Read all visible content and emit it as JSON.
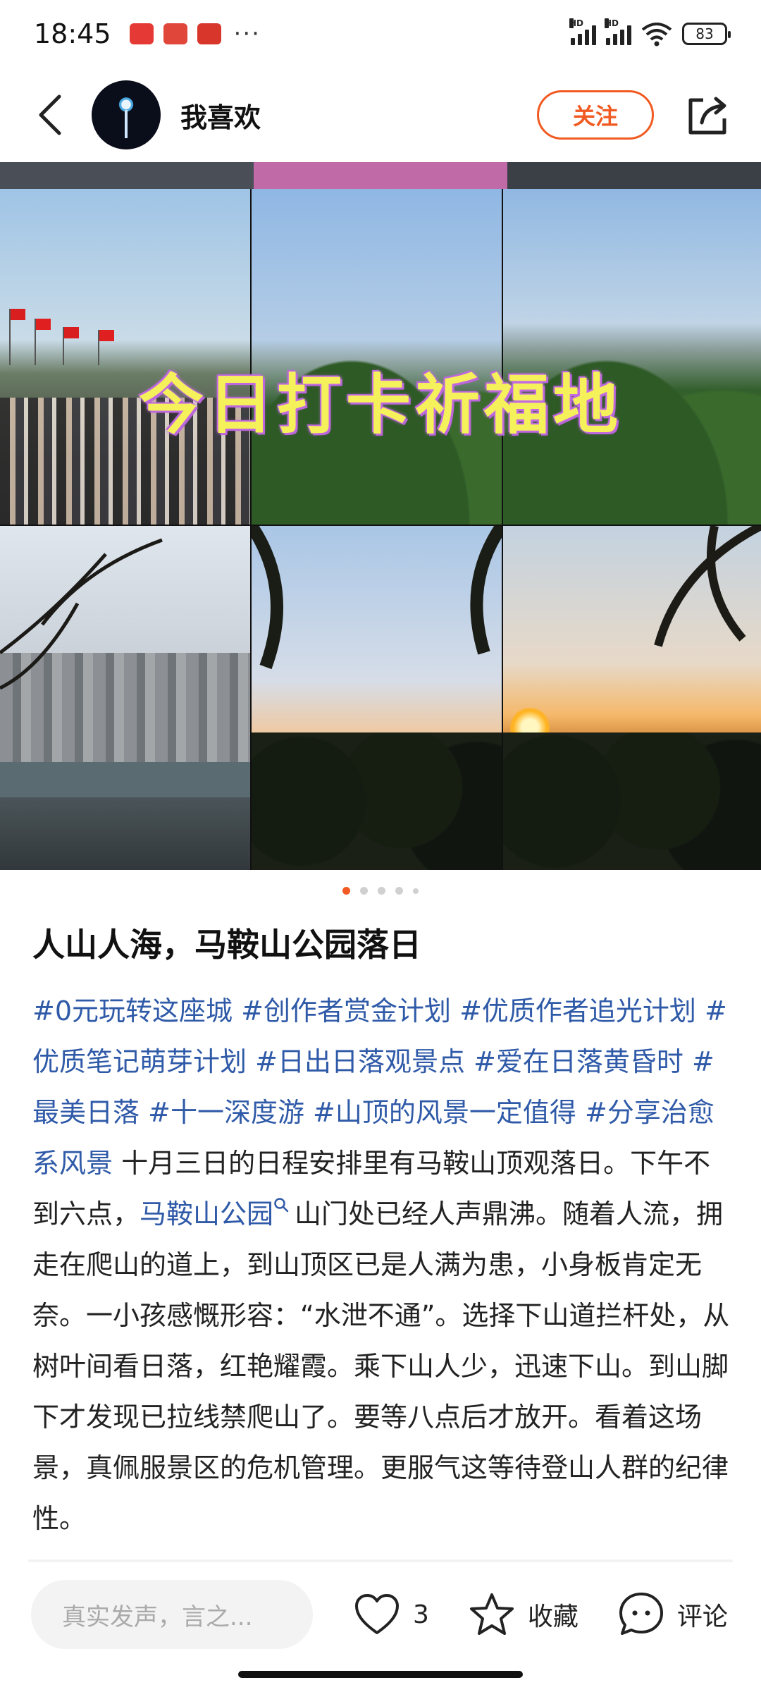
{
  "status_bar": {
    "time": "18:45",
    "notification_icons": [
      "notification-app-icon",
      "notification-app-icon",
      "notification-app-icon"
    ],
    "more": "···",
    "network_1": "HD",
    "network_2": "HD",
    "battery": "83"
  },
  "header": {
    "author_name": "我喜欢",
    "follow_label": "关注"
  },
  "post": {
    "image_overlay_text": "今日打卡祈福地",
    "carousel": {
      "total": 5,
      "active_index": 0
    },
    "title": "人山人海，马鞍山公园落日",
    "tags": [
      "#0元玩转这座城",
      "#创作者赏金计划",
      "#优质作者追光计划",
      "#优质笔记萌芽计划",
      "#日出日落观景点",
      "#爱在日落黄昏时",
      "#最美日落",
      "#十一深度游",
      "#山顶的风景一定值得",
      "#分享治愈系风景"
    ],
    "text_part1": "十月三日的日程安排里有马鞍山顶观落日。下午不到六点，",
    "place_link": "马鞍山公园",
    "text_part2": "山门处已经人声鼎沸。随着人流，拥走在爬山的道上，到山顶区已是人满为患，小身板肯定无奈。一小孩感慨形容：“水泄不通”。选择下山道拦杆处，从树叶间看日落，红艳耀霞。乘下山人少，迅速下山。到山脚下才发现已拉线禁爬山了。要等八点后才放开。看着这场景，真佩服景区的危机管理。更服气这等待登山人群的纪律性。"
  },
  "bottom_bar": {
    "comment_placeholder": "真实发声，言之...",
    "like_count": "3",
    "collect_label": "收藏",
    "comment_label": "评论"
  },
  "colors": {
    "accent": "#f15a22",
    "tag": "#2f5aa8",
    "overlay_text": "#f5f15a"
  }
}
